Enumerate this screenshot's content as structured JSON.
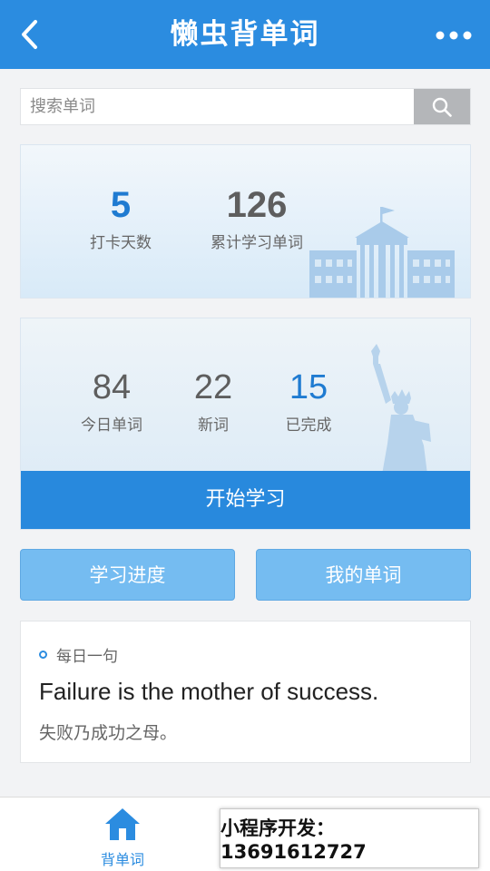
{
  "header": {
    "title": "懒虫背单词",
    "back_icon": "chevron-left-icon",
    "more_icon": "more-dots-icon"
  },
  "search": {
    "placeholder": "搜索单词",
    "button_icon": "search-icon"
  },
  "checkin_card": {
    "days_value": "5",
    "days_label": "打卡天数",
    "total_value": "126",
    "total_label": "累计学习单词"
  },
  "today_card": {
    "today_value": "84",
    "today_label": "今日单词",
    "new_value": "22",
    "new_label": "新词",
    "done_value": "15",
    "done_label": "已完成",
    "start_label": "开始学习"
  },
  "actions": {
    "progress_label": "学习进度",
    "mywords_label": "我的单词"
  },
  "daily_quote": {
    "tag": "每日一句",
    "english": "Failure is the mother of success.",
    "chinese": "失败乃成功之母。"
  },
  "tabbar": {
    "tabs": [
      {
        "label": "背单词",
        "icon": "home-icon",
        "active": true
      },
      {
        "label": "",
        "icon": "user-icon",
        "active": false
      }
    ]
  },
  "promo": {
    "text": "小程序开发：13691612727"
  },
  "colors": {
    "primary": "#2b8ce0",
    "accent_number": "#1f7bd1",
    "secondary_button": "#75bcf1"
  }
}
